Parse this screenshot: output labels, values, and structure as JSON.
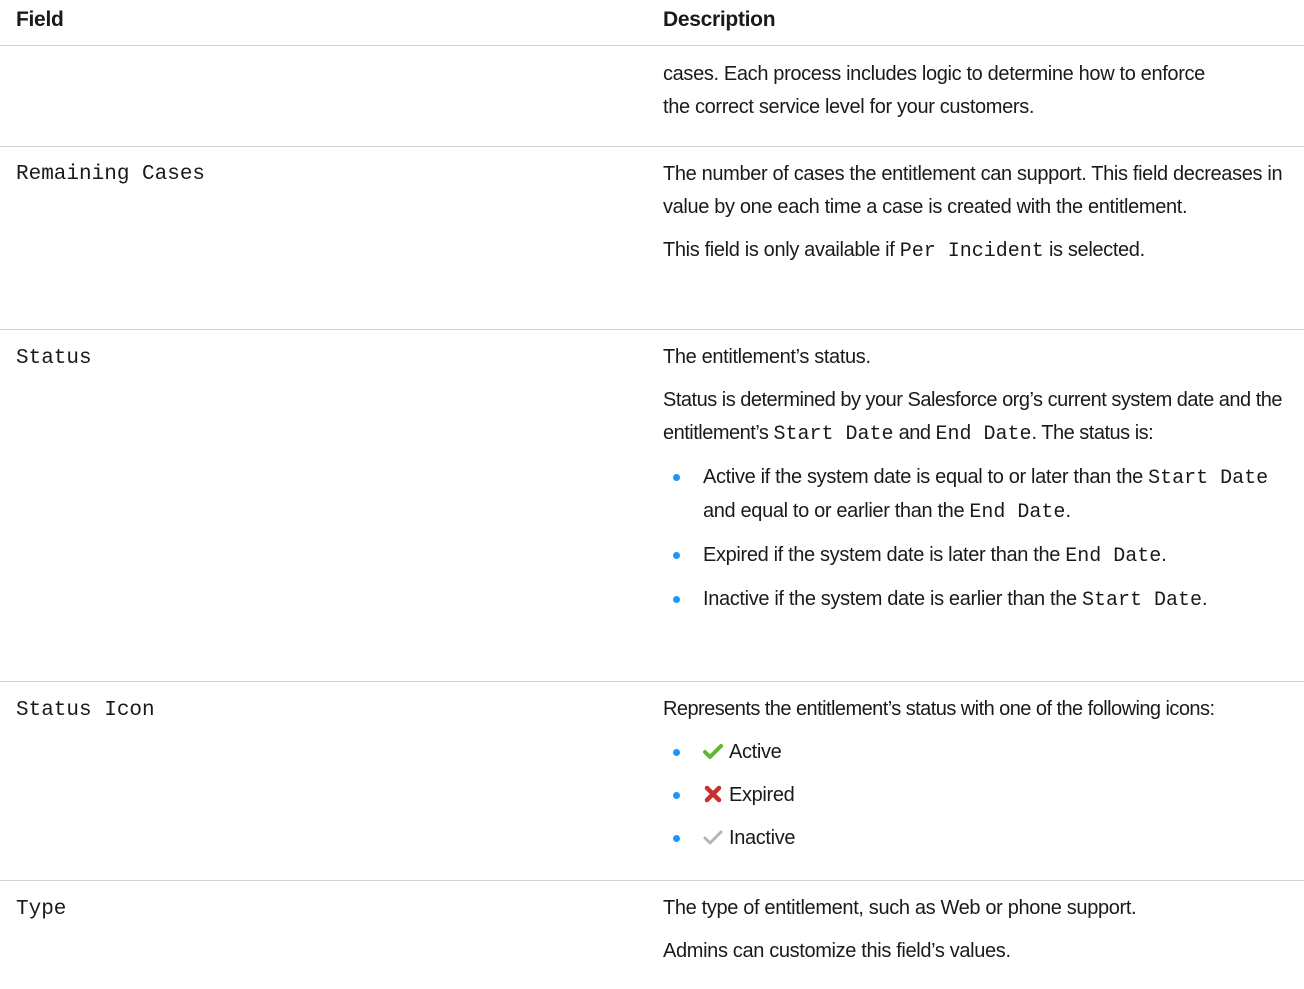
{
  "header": {
    "field": "Field",
    "description": "Description"
  },
  "rows": {
    "continuation": {
      "line1": "cases. Each process includes logic to determine how to enforce",
      "line2": "the correct service level for your customers."
    },
    "remaining_cases": {
      "field": "Remaining Cases",
      "p1": "The number of cases the entitlement can support. This field decreases in value by one each time a case is created with the entitlement.",
      "p2_pre": "This field is only available if ",
      "p2_code": "Per Incident",
      "p2_post": " is selected."
    },
    "status": {
      "field": "Status",
      "p1": "The entitlement’s status.",
      "p2_a": "Status is determined by your Salesforce org’s current system date and the entitlement’s ",
      "p2_code1": "Start Date",
      "p2_b": " and ",
      "p2_code2": "End Date",
      "p2_c": ". The status is:",
      "b1_a": "Active if the system date is equal to or later than the ",
      "b1_code1": "Start Date",
      "b1_b": " and equal to or earlier than the ",
      "b1_code2": "End Date",
      "b1_c": ".",
      "b2_a": "Expired if the system date is later than the ",
      "b2_code": "End Date",
      "b2_b": ".",
      "b3_a": "Inactive if the system date is earlier than the ",
      "b3_code": "Start Date",
      "b3_b": "."
    },
    "status_icon": {
      "field": "Status Icon",
      "p1": "Represents the entitlement’s status with one of the following icons:",
      "items": [
        {
          "icon": "green-check-icon",
          "label": "Active"
        },
        {
          "icon": "red-x-icon",
          "label": "Expired"
        },
        {
          "icon": "gray-check-icon",
          "label": "Inactive"
        }
      ]
    },
    "type": {
      "field": "Type",
      "p1": "The type of entitlement, such as Web or phone support.",
      "p2": "Admins can customize this field’s values."
    }
  },
  "colors": {
    "bullet": "#1b96ff",
    "divider": "#d4d4d4",
    "active_icon": "#5cb82e",
    "expired_icon": "#c9302c",
    "inactive_icon": "#b5b5b5"
  }
}
